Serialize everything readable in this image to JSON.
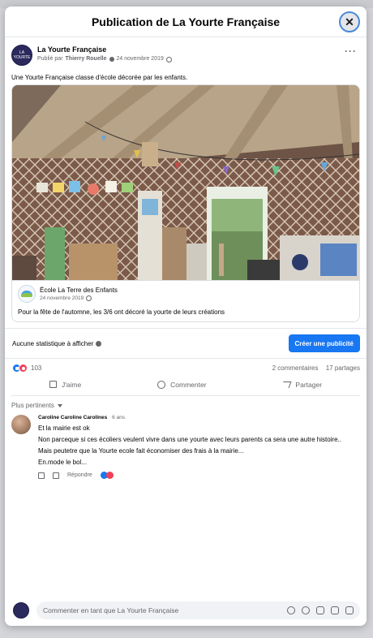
{
  "modal": {
    "title": "Publication de La Yourte Française",
    "close_icon": "close-icon"
  },
  "post": {
    "page_name": "La Yourte Française",
    "avatar_text": "LA YOURTE",
    "published_by_prefix": "Publié par",
    "published_by": "Thierry Rouelle",
    "date": "24 novembre 2019",
    "text": "Une Yourte Française classe d'école décorée par les enfants.",
    "link": {
      "name": "École La Terre des Enfants",
      "date": "24 novembre 2019",
      "description": "Pour la fête de l'automne, les 3/6 ont décoré la yourte de leurs créations"
    }
  },
  "stats": {
    "no_stats_label": "Aucune statistique à afficher",
    "boost_label": "Créer une publicité"
  },
  "reactions": {
    "count": "103",
    "comments": "2 commentaires",
    "shares": "17 partages"
  },
  "actions": {
    "like": "J'aime",
    "comment": "Commenter",
    "share": "Partager"
  },
  "sort": {
    "label": "Plus pertinents"
  },
  "comment": {
    "author": "Caroline Caroline Carolines",
    "ago": "6 ans",
    "lines": [
      "Et la mairie est ok",
      "Non parceque si ces écoliers veulent vivre dans une yourte avec leurs parents ca sera une autre histoire..",
      "Mais peutetre que la Yourte ecole fait économiser des frais à la mairie...",
      "En.mode le bol..."
    ],
    "reply_label": "Répondre"
  },
  "composer": {
    "placeholder": "Commenter en tant que La Yourte Française"
  },
  "colors": {
    "accent": "#1877f2",
    "love": "#f33e58",
    "muted_text": "#65676b"
  }
}
